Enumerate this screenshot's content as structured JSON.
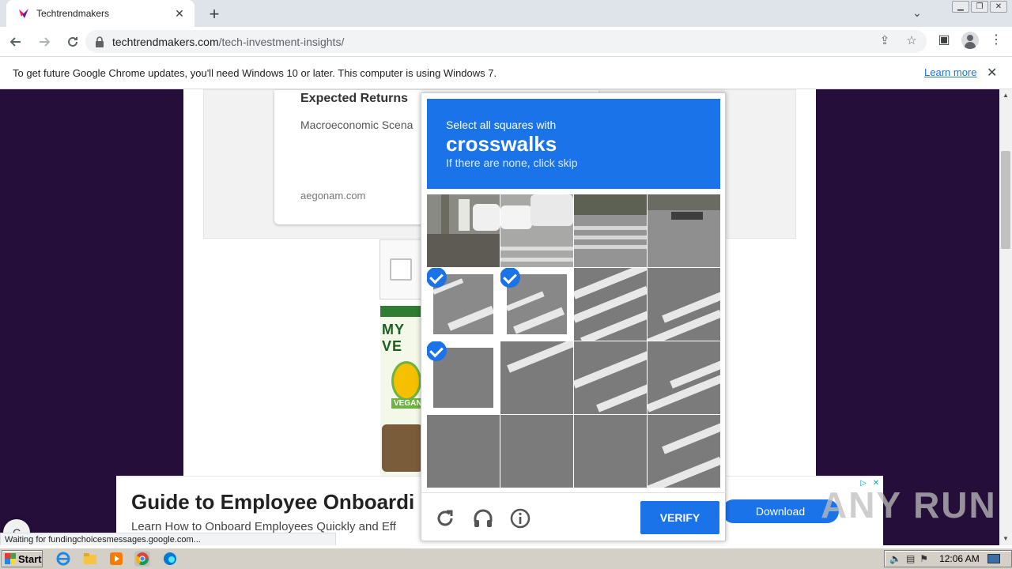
{
  "browser": {
    "tab_title": "Techtrendmakers",
    "url_host": "techtrendmakers.com",
    "url_path": "/tech-investment-insights/",
    "infobar_text": "To get future Google Chrome updates, you'll need Windows 10 or later. This computer is using Windows 7.",
    "infobar_link": "Learn more",
    "status_text": "Waiting for fundingchoicesmessages.google.com..."
  },
  "page": {
    "card_title": "Expected Returns",
    "card_subtitle": "Macroeconomic Scena",
    "card_source": "aegonam.com",
    "ad_headline": "Guide to Employee Onboardi",
    "ad_subline": "Learn How to Onboard Employees Quickly and Eff",
    "ad_button": "Download",
    "side_ad_brand": "MY VE",
    "side_ad_tag": "VEGAN",
    "watermark": "ANY RUN"
  },
  "captcha": {
    "lead": "Select all squares with",
    "target": "crosswalks",
    "hint": "If there are none, click skip",
    "verify_label": "VERIFY",
    "selected_tiles": [
      4,
      5,
      8
    ],
    "accent_color": "#1a73e8"
  },
  "taskbar": {
    "start_label": "Start",
    "clock": "12:06 AM"
  }
}
